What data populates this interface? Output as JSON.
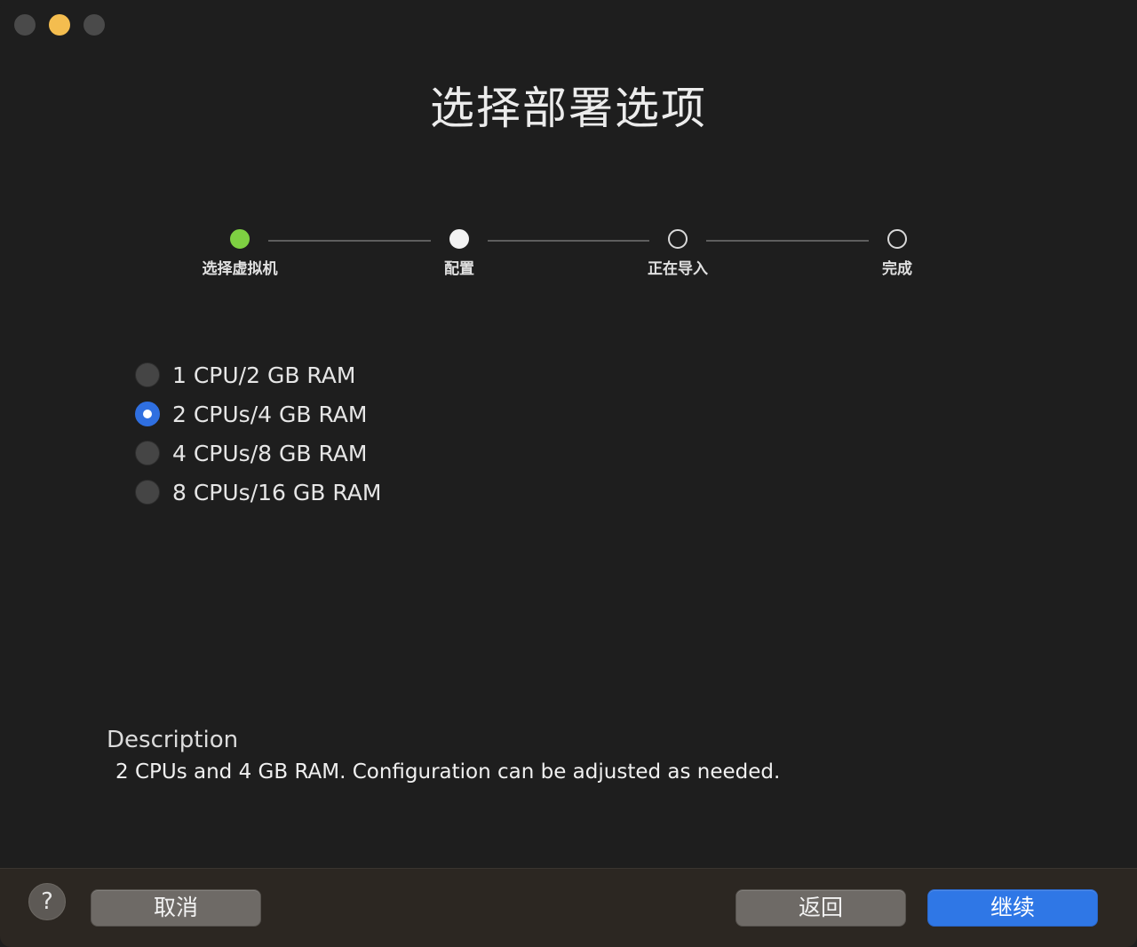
{
  "window": {
    "traffic_lights": [
      "close",
      "minimize",
      "zoom"
    ]
  },
  "title": "选择部署选项",
  "stepper": {
    "steps": [
      {
        "label": "选择虚拟机",
        "state": "done"
      },
      {
        "label": "配置",
        "state": "current"
      },
      {
        "label": "正在导入",
        "state": "pending"
      },
      {
        "label": "完成",
        "state": "pending"
      }
    ]
  },
  "options": {
    "items": [
      {
        "label": "1 CPU/2 GB RAM",
        "selected": false
      },
      {
        "label": "2 CPUs/4 GB RAM",
        "selected": true
      },
      {
        "label": "4 CPUs/8 GB RAM",
        "selected": false
      },
      {
        "label": "8 CPUs/16 GB RAM",
        "selected": false
      }
    ]
  },
  "description": {
    "title": "Description",
    "text": "2 CPUs and 4 GB RAM. Configuration can be adjusted as needed."
  },
  "footer": {
    "help_label": "?",
    "cancel_label": "取消",
    "back_label": "返回",
    "continue_label": "继续"
  },
  "colors": {
    "background": "#1e1e1e",
    "step_done": "#7ed042",
    "accent": "#2f77e6",
    "minimize": "#f4bd4f"
  }
}
